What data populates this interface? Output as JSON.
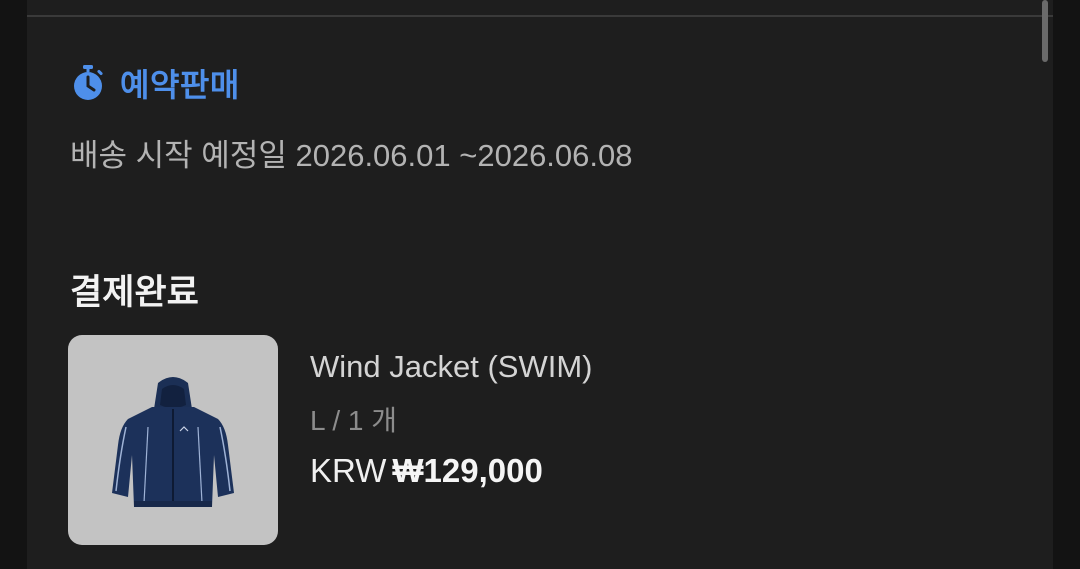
{
  "preorder": {
    "label": "예약판매",
    "icon": "stopwatch-icon",
    "color": "#4e8fea"
  },
  "shipping": {
    "text": "배송 시작 예정일 2026.06.01 ~2026.06.08"
  },
  "order": {
    "status": "결제완료"
  },
  "product": {
    "name": "Wind Jacket (SWIM)",
    "option": "L / 1 개",
    "currency": "KRW",
    "price": "₩129,000",
    "image": "navy-wind-jacket-image"
  }
}
